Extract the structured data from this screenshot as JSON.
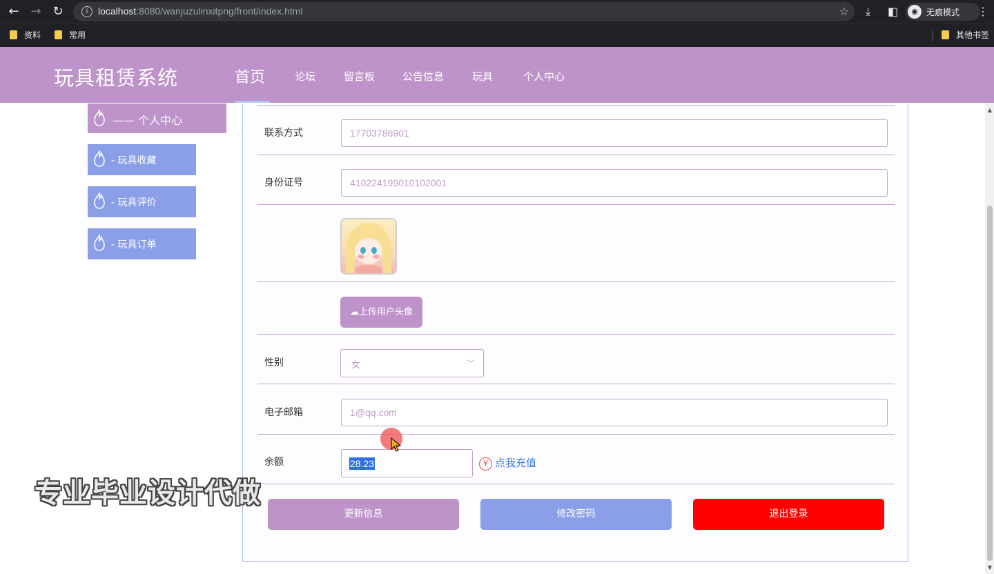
{
  "browser": {
    "url_host": "localhost",
    "url_rest": ":8080/wanjuzulinxitpng/front/index.html",
    "incognito_label": "无痕模式",
    "bookmarks": [
      "资料",
      "常用"
    ],
    "other_bookmarks": "其他书签"
  },
  "header": {
    "title": "玩具租赁系统",
    "nav": [
      "首页",
      "论坛",
      "留言板",
      "公告信息",
      "玩具",
      "个人中心"
    ]
  },
  "sidebar": {
    "main": "—— 个人中心",
    "items": [
      "-  玩具收藏",
      "-  玩具评价",
      "-  玩具订单"
    ]
  },
  "form": {
    "phone_label": "联系方式",
    "phone_value": "17703786901",
    "id_label": "身份证号",
    "id_value": "410224199010102001",
    "upload_label": "上传用户头像",
    "gender_label": "性别",
    "gender_value": "女",
    "email_label": "电子邮箱",
    "email_value": "1@qq.com",
    "balance_label": "余额",
    "balance_value": "28.23",
    "recharge_label": "点我充值",
    "yen_symbol": "¥"
  },
  "buttons": {
    "update": "更新信息",
    "change_password": "修改密码",
    "logout": "退出登录"
  },
  "colors": {
    "header": "#bd93c9",
    "sidebar_item": "#8a9fe8",
    "logout": "#ff0000"
  },
  "watermark": "专业毕业设计代做"
}
